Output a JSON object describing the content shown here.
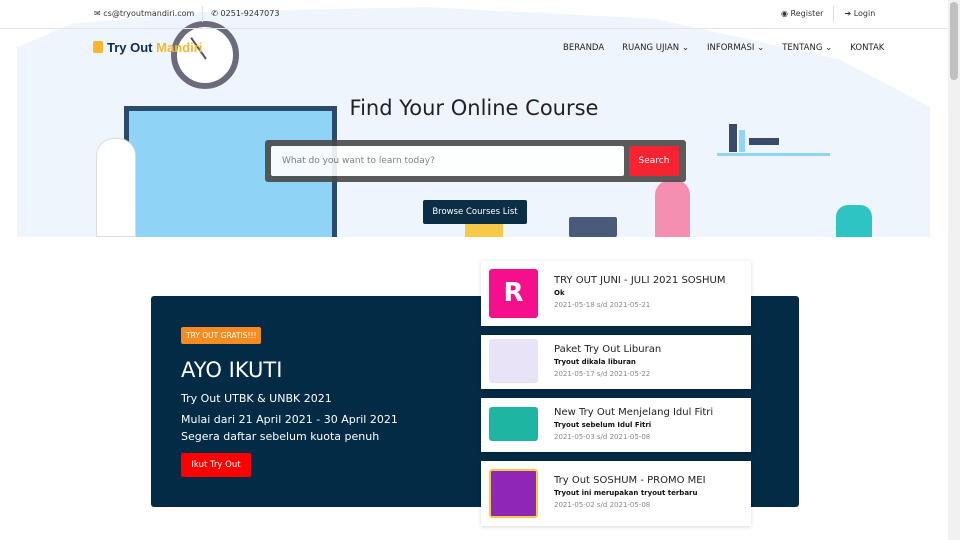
{
  "topbar": {
    "email": "cs@tryoutmandiri.com",
    "phone": "0251-9247073",
    "register": "Register",
    "login": "Login"
  },
  "logo": {
    "part1": "Try Out",
    "part2": "Mandiri"
  },
  "nav": [
    "BERANDA",
    "RUANG UJIAN",
    "INFORMASI",
    "TENTANG",
    "KONTAK"
  ],
  "hero": {
    "title": "Find Your Online Course",
    "search_placeholder": "What do you want to learn today?",
    "search_button": "Search",
    "browse_button": "Browse Courses List"
  },
  "promo": {
    "badge": "TRY OUT GRATIS!!!",
    "heading": "AYO IKUTI",
    "subtitle": "Try Out UTBK & UNBK 2021",
    "date": "Mulai dari 21 April 2021 - 30 April 2021",
    "note": "Segera daftar sebelum kuota penuh",
    "button": "Ikut Try Out"
  },
  "courses": [
    {
      "title": "TRY OUT JUNI - JULI 2021 SOSHUM",
      "desc": "Ok",
      "dates": "2021-05-18 s/d 2021-05-21",
      "color": "#f50f8c"
    },
    {
      "title": "Paket Try Out Liburan",
      "desc": "Tryout dikala liburan",
      "dates": "2021-05-17 s/d 2021-05-22",
      "color": "#e9e3f7"
    },
    {
      "title": "New Try Out Menjelang Idul Fitri",
      "desc": "Tryout sebelum Idul Fitri",
      "dates": "2021-05-03 s/d 2021-05-08",
      "color": "#1fb5a3"
    },
    {
      "title": "Try Out SOSHUM - PROMO MEI",
      "desc": "Tryout ini merupakan tryout terbaru",
      "dates": "2021-05-02 s/d 2021-05-08",
      "color": "#8e27b8"
    }
  ]
}
